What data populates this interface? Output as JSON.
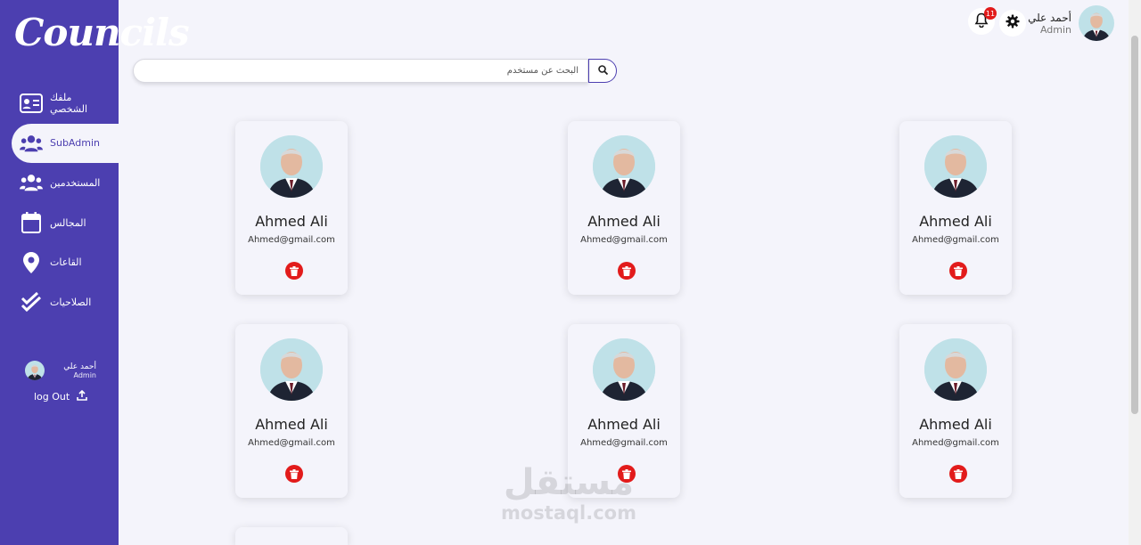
{
  "brand": {
    "logo_text": "Councils"
  },
  "sidebar": {
    "items": [
      {
        "label": "ملفك الشخصي",
        "icon": "id-card-icon",
        "active": false
      },
      {
        "label": "SubAdmin",
        "icon": "users-icon",
        "active": true
      },
      {
        "label": "المستخدمين",
        "icon": "users-icon",
        "active": false
      },
      {
        "label": "المجالس",
        "icon": "calendar-icon",
        "active": false
      },
      {
        "label": "القاعات",
        "icon": "map-pin-icon",
        "active": false
      },
      {
        "label": "الصلاحيات",
        "icon": "double-check-icon",
        "active": false
      }
    ],
    "user": {
      "name": "أحمد علي",
      "role": "Admin"
    },
    "logout_label": "log Out"
  },
  "header": {
    "user_name": "أحمد علي",
    "user_role": "Admin",
    "notifications_count": "11"
  },
  "search": {
    "placeholder": "البحث عن مستخدم",
    "value": ""
  },
  "cards": [
    {
      "name": "Ahmed Ali",
      "email": "Ahmed@gmail.com"
    },
    {
      "name": "Ahmed Ali",
      "email": "Ahmed@gmail.com"
    },
    {
      "name": "Ahmed Ali",
      "email": "Ahmed@gmail.com"
    },
    {
      "name": "Ahmed Ali",
      "email": "Ahmed@gmail.com"
    },
    {
      "name": "Ahmed Ali",
      "email": "Ahmed@gmail.com"
    },
    {
      "name": "Ahmed Ali",
      "email": "Ahmed@gmail.com"
    }
  ],
  "watermark": {
    "arabic": "مستقل",
    "latin": "mostaql.com"
  },
  "colors": {
    "sidebar": "#4c3fb0",
    "danger": "#e21b1b",
    "background": "#f4f4fb"
  }
}
